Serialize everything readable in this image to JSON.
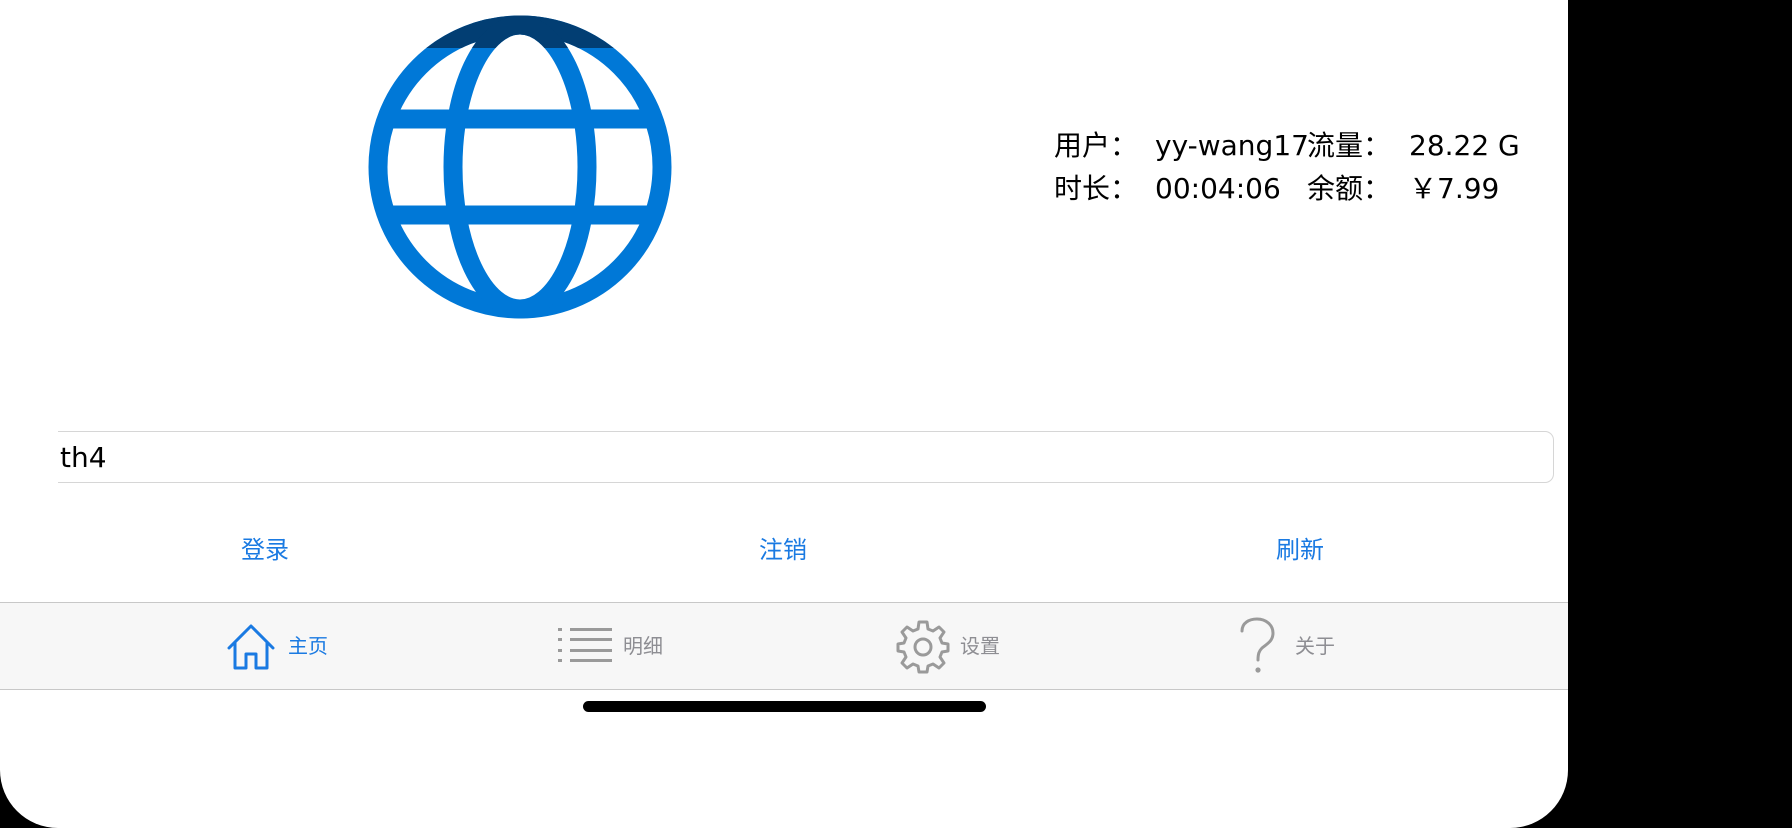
{
  "info": {
    "user_label": "用户：",
    "user_value": "yy-wang17",
    "traffic_label": "流量：",
    "traffic_value": "28.22 G",
    "duration_label": "时长：",
    "duration_value": "00:04:06",
    "balance_label": "余额：",
    "balance_value": "￥7.99"
  },
  "username_input": {
    "value": "th4"
  },
  "actions": {
    "login": "登录",
    "logout": "注销",
    "refresh": "刷新"
  },
  "tab_bar": {
    "home": "主页",
    "detail": "明细",
    "settings": "设置",
    "about": "关于"
  },
  "colors": {
    "accent": "#1a7ae2",
    "globe": "#0078d7",
    "globe_top": "#023e73",
    "tab_inactive": "#8e8e93"
  },
  "icons": {
    "header": "globe-icon",
    "home": "house-icon",
    "detail": "list-icon",
    "settings": "gear-icon",
    "about": "question-mark-icon"
  },
  "active_tab": "home"
}
